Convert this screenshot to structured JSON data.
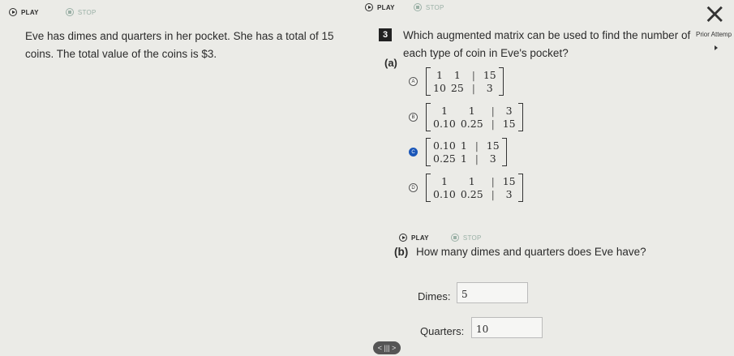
{
  "media_controls": [
    {
      "play": "PLAY",
      "stop": "STOP"
    },
    {
      "play": "PLAY",
      "stop": "STOP"
    },
    {
      "play": "PLAY",
      "stop": "STOP"
    }
  ],
  "close_glyph": "×",
  "prior_attempts": "Prior Attemp",
  "problem_text_line1": "Eve has dimes and quarters in her pocket. She has a total of 15",
  "problem_text_line2": "coins. The total value of the coins is $3.",
  "question_number": "3",
  "part_a": {
    "label": "(a)",
    "prompt_line1": "Which augmented matrix can be used to find the number of",
    "prompt_line2": "each type of coin in Eve's pocket?",
    "selected": "C",
    "options": [
      {
        "letter": "A",
        "rows": [
          [
            "1",
            "1",
            "15"
          ],
          [
            "10",
            "25",
            "3"
          ]
        ]
      },
      {
        "letter": "B",
        "rows": [
          [
            "1",
            "1",
            "3"
          ],
          [
            "0.10",
            "0.25",
            "15"
          ]
        ]
      },
      {
        "letter": "C",
        "rows": [
          [
            "0.10",
            "1",
            "15"
          ],
          [
            "0.25",
            "1",
            "3"
          ]
        ]
      },
      {
        "letter": "D",
        "rows": [
          [
            "1",
            "1",
            "15"
          ],
          [
            "0.10",
            "0.25",
            "3"
          ]
        ]
      }
    ]
  },
  "part_b": {
    "label": "(b)",
    "prompt": "How many dimes and quarters does Eve have?",
    "dimes_label": "Dimes:",
    "dimes_value": "5",
    "quarters_label": "Quarters:",
    "quarters_value": "10"
  },
  "pager_glyph": "< ||| >"
}
